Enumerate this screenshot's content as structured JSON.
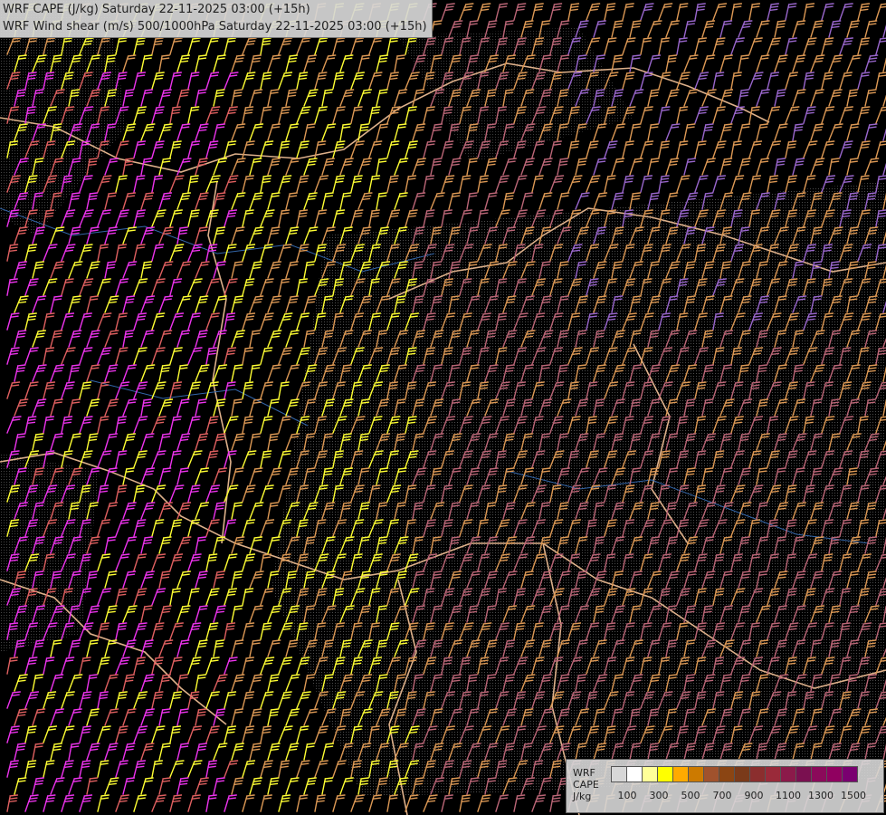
{
  "header": {
    "line1": "WRF CAPE (J/kg) Saturday 22-11-2025 03:00 (+15h)",
    "line2": "WRF Wind shear (m/s) 500/1000hPa Saturday 22-11-2025 03:00 (+15h)"
  },
  "legend": {
    "title_lines": [
      "WRF",
      "CAPE",
      "J/kg"
    ],
    "swatch_colors": [
      "#d7d7d7",
      "#ffffff",
      "#ffff99",
      "#ffff00",
      "#ffaa00",
      "#cc7a00",
      "#a0522d",
      "#8b4513",
      "#7a3a1a",
      "#8b2e2e",
      "#9a2a3a",
      "#8b1a4a",
      "#7a1050",
      "#8b0a5a",
      "#900060",
      "#7a0070"
    ],
    "tick_labels": [
      "100",
      "300",
      "500",
      "700",
      "900",
      "1100",
      "1300",
      "1500"
    ]
  },
  "colors": {
    "background": "#000000",
    "barb_palette": [
      "#ffff33",
      "#ee33ee",
      "#cc8866",
      "#bb6677",
      "#9966cc",
      "#dd9955",
      "#e06060"
    ],
    "border": "#ddb08a",
    "river": "#3366aa",
    "contour": "#888888"
  }
}
